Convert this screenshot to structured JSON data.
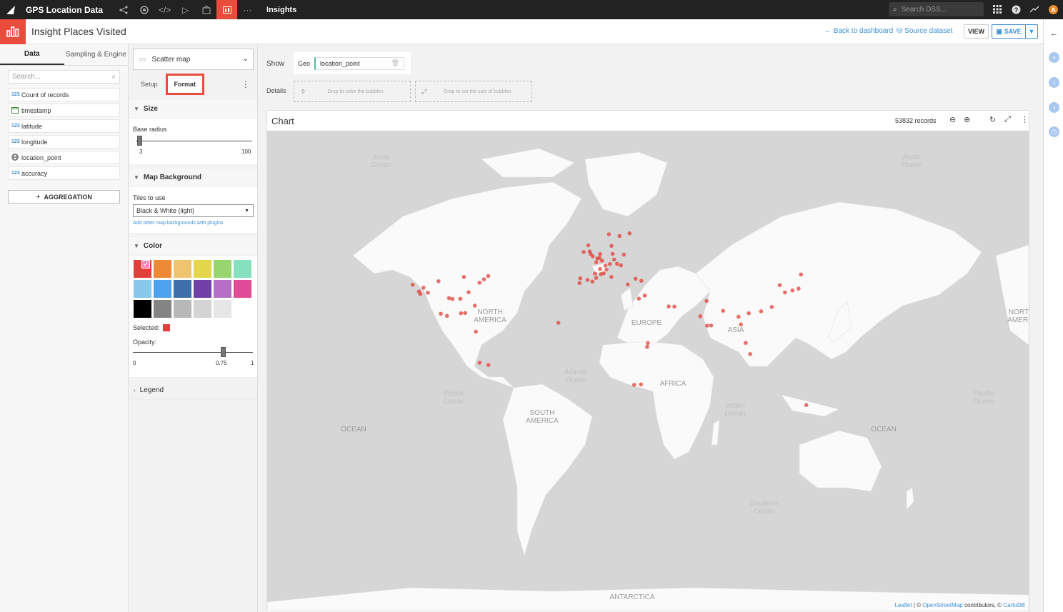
{
  "topnav": {
    "project": "GPS Location Data",
    "section": "Insights",
    "search_placeholder": "Search DSS...",
    "avatar": "A"
  },
  "header": {
    "title": "Insight Places Visited",
    "back_link": "Back to dashboard",
    "source_link": "Source dataset",
    "view_label": "VIEW",
    "save_label": "SAVE"
  },
  "left": {
    "tabs": [
      "Data",
      "Sampling & Engine"
    ],
    "search_placeholder": "Search...",
    "columns": [
      {
        "type": "123",
        "name": "Count of records"
      },
      {
        "type": "date",
        "name": "timestamp"
      },
      {
        "type": "123",
        "name": "latitude"
      },
      {
        "type": "123",
        "name": "longitude"
      },
      {
        "type": "geo",
        "name": "location_point"
      },
      {
        "type": "123",
        "name": "accuracy"
      }
    ],
    "aggregation_label": "AGGREGATION"
  },
  "format": {
    "chart_type": "Scatter map",
    "tabs": {
      "setup": "Setup",
      "format": "Format"
    },
    "size": {
      "title": "Size",
      "base_radius_label": "Base radius",
      "min": "3",
      "max": "100",
      "value_fraction": 0.0
    },
    "background": {
      "title": "Map Background",
      "tiles_label": "Tiles to use",
      "tiles_value": "Black & White (light)",
      "plugins_link": "Add other map backgrounds with plugins"
    },
    "color": {
      "title": "Color",
      "swatches": [
        "#e0403a",
        "#ee8a36",
        "#eec46e",
        "#e4d64a",
        "#97d56e",
        "#84e0bd",
        "#88c8ea",
        "#4ea3ee",
        "#3e6fa8",
        "#7040a8",
        "#b56fc4",
        "#e04a96",
        "#000000",
        "#848484",
        "#b8b8b8",
        "#d4d4d4",
        "#e6e6e6"
      ],
      "selected_label": "Selected:",
      "selected_color": "#e0403a",
      "opacity_label": "Opacity:",
      "opacity_min": "0",
      "opacity_value": "0.75",
      "opacity_max": "1"
    },
    "legend_title": "Legend"
  },
  "main": {
    "show_label": "Show",
    "geo_label": "Geo",
    "geo_value": "location_point",
    "details_label": "Details",
    "drop_color": "Drop to color the bubbles",
    "drop_size": "Drop to set the size of bubbles",
    "chart_title": "Chart",
    "records": "53832 records",
    "attribution": {
      "leaflet": "Leaflet",
      "osm": "OpenStreetMap",
      "mid": " contributors, © ",
      "carto": "CartoDB",
      "pre": " | © "
    }
  },
  "map_labels": {
    "arctic1": "Arctic\nOcean",
    "arctic2": "Arctic\nOcean",
    "north_america": "NORTH\nAMERICA",
    "north_america2": "NORT\nAMERI",
    "europe": "EUROPE",
    "asia": "ASIA",
    "atlantic": "Atlantic\nOcean",
    "africa": "AFRICA",
    "pacific1": "Pacific\nOcean",
    "pacific2": "Pacific\nOcean",
    "south_america": "SOUTH\nAMERICA",
    "indian": "Indian\nOcean",
    "ocean1": "OCEAN",
    "ocean2": "OCEAN",
    "southern": "Southern\nOcean",
    "antarctica": "ANTARCTICA"
  },
  "points_color": "#e0403a",
  "points": [
    [
      -122.4,
      37.8
    ],
    [
      -118.2,
      34.1
    ],
    [
      -117.2,
      32.7
    ],
    [
      -115.1,
      36.2
    ],
    [
      -112.1,
      33.4
    ],
    [
      -104.9,
      39.7
    ],
    [
      -97.7,
      30.3
    ],
    [
      -95.4,
      29.8
    ],
    [
      -90.1,
      29.9
    ],
    [
      -87.6,
      41.9
    ],
    [
      -84.4,
      33.7
    ],
    [
      -80.2,
      25.8
    ],
    [
      -77.0,
      38.9
    ],
    [
      -74.0,
      40.7
    ],
    [
      -71.1,
      42.4
    ],
    [
      -99.1,
      19.4
    ],
    [
      -103.3,
      20.7
    ],
    [
      -86.8,
      21.2
    ],
    [
      -89.6,
      21.0
    ],
    [
      -79.5,
      9.0
    ],
    [
      -77.0,
      -12.0
    ],
    [
      -71.0,
      -13.5
    ],
    [
      -23.5,
      14.9
    ],
    [
      -9.1,
      38.7
    ],
    [
      -3.7,
      40.4
    ],
    [
      2.3,
      48.9
    ],
    [
      4.9,
      52.4
    ],
    [
      4.4,
      50.8
    ],
    [
      6.1,
      49.6
    ],
    [
      8.5,
      47.4
    ],
    [
      11.6,
      48.1
    ],
    [
      13.4,
      52.5
    ],
    [
      12.5,
      41.9
    ],
    [
      9.2,
      45.5
    ],
    [
      14.4,
      50.1
    ],
    [
      16.4,
      48.2
    ],
    [
      19.0,
      47.5
    ],
    [
      21.0,
      52.2
    ],
    [
      18.1,
      59.3
    ],
    [
      10.8,
      59.9
    ],
    [
      24.9,
      60.2
    ],
    [
      12.6,
      55.7
    ],
    [
      -0.1,
      51.5
    ],
    [
      -2.2,
      53.5
    ],
    [
      -6.3,
      53.3
    ],
    [
      -3.2,
      55.9
    ],
    [
      -1.5,
      52.4
    ],
    [
      2.2,
      41.4
    ],
    [
      28.9,
      41.0
    ],
    [
      23.7,
      38.0
    ],
    [
      32.9,
      39.9
    ],
    [
      31.2,
      30.0
    ],
    [
      35.2,
      31.8
    ],
    [
      55.3,
      25.2
    ],
    [
      51.5,
      25.3
    ],
    [
      72.9,
      19.1
    ],
    [
      77.2,
      28.6
    ],
    [
      77.6,
      13.0
    ],
    [
      80.3,
      13.1
    ],
    [
      88.4,
      22.6
    ],
    [
      100.5,
      13.8
    ],
    [
      98.9,
      18.8
    ],
    [
      103.8,
      1.35
    ],
    [
      106.8,
      -6.2
    ],
    [
      105.8,
      21.0
    ],
    [
      114.2,
      22.3
    ],
    [
      121.5,
      25.0
    ],
    [
      126.9,
      37.6
    ],
    [
      135.5,
      34.7
    ],
    [
      139.7,
      35.7
    ],
    [
      141.3,
      43.1
    ],
    [
      130.4,
      33.6
    ],
    [
      36.8,
      -1.3
    ],
    [
      37.3,
      1.2
    ],
    [
      32.6,
      -25.9
    ],
    [
      28.0,
      -26.2
    ],
    [
      144.9,
      -37.8
    ],
    [
      -0.4,
      39.5
    ],
    [
      -8.6,
      41.2
    ],
    [
      3.0,
      50.6
    ],
    [
      5.4,
      43.3
    ],
    [
      7.3,
      43.7
    ],
    [
      4.8,
      45.8
    ],
    [
      1.4,
      43.6
    ]
  ]
}
